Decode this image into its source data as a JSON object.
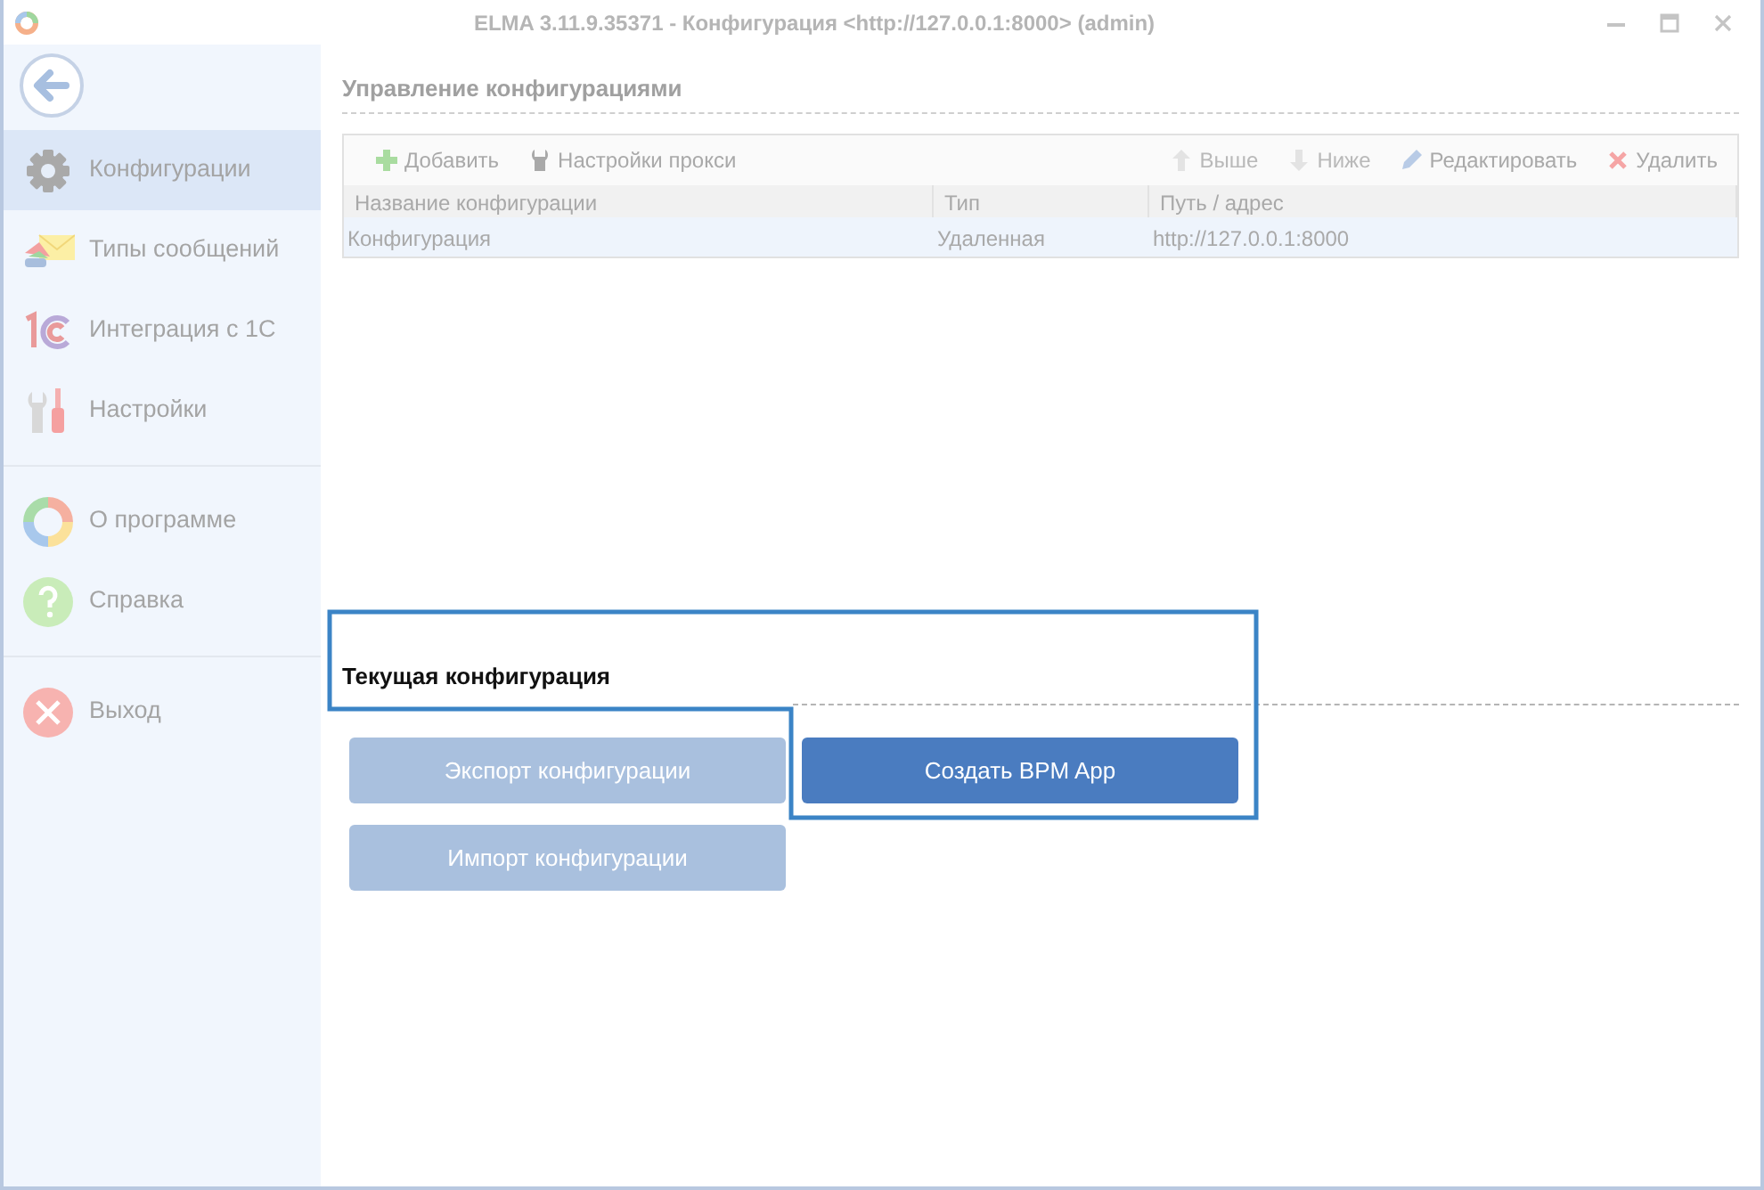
{
  "window": {
    "title": "ELMA 3.11.9.35371 - Конфигурация <http://127.0.0.1:8000> (admin)"
  },
  "sidebar": {
    "groups": [
      [
        {
          "kind": "gear",
          "label": "Конфигурации",
          "selected": true
        },
        {
          "kind": "mail",
          "label": "Типы сообщений",
          "selected": false
        },
        {
          "kind": "onec",
          "label": "Интеграция с 1С",
          "selected": false
        },
        {
          "kind": "tools",
          "label": "Настройки",
          "selected": false
        }
      ],
      [
        {
          "kind": "ring",
          "label": "О программе",
          "selected": false
        },
        {
          "kind": "help",
          "label": "Справка",
          "selected": false
        }
      ],
      [
        {
          "kind": "exit",
          "label": "Выход",
          "selected": false
        }
      ]
    ]
  },
  "configurations": {
    "title": "Управление конфигурациями",
    "toolbar": [
      {
        "kind": "add",
        "label": "Добавить",
        "disabled": false
      },
      {
        "kind": "proxy",
        "label": "Настройки прокси",
        "disabled": false
      },
      {
        "kind": "spacer"
      },
      {
        "kind": "up",
        "label": "Выше",
        "disabled": true
      },
      {
        "kind": "down",
        "label": "Ниже",
        "disabled": true
      },
      {
        "kind": "edit",
        "label": "Редактировать",
        "disabled": false
      },
      {
        "kind": "delete",
        "label": "Удалить",
        "disabled": false
      }
    ],
    "columns": [
      "Название конфигурации",
      "Тип",
      "Путь / адрес"
    ],
    "rows": [
      {
        "cells": [
          "Конфигурация",
          "Удаленная",
          "http://127.0.0.1:8000"
        ],
        "selected": true
      }
    ]
  },
  "current_configuration": {
    "title": "Текущая конфигурация",
    "highlighted": true,
    "buttons": [
      {
        "label": "Экспорт конфигурации",
        "primary": false
      },
      {
        "label": "Создать BPM App",
        "primary": true
      },
      {
        "label": "Импорт конфигурации",
        "primary": false
      }
    ]
  }
}
